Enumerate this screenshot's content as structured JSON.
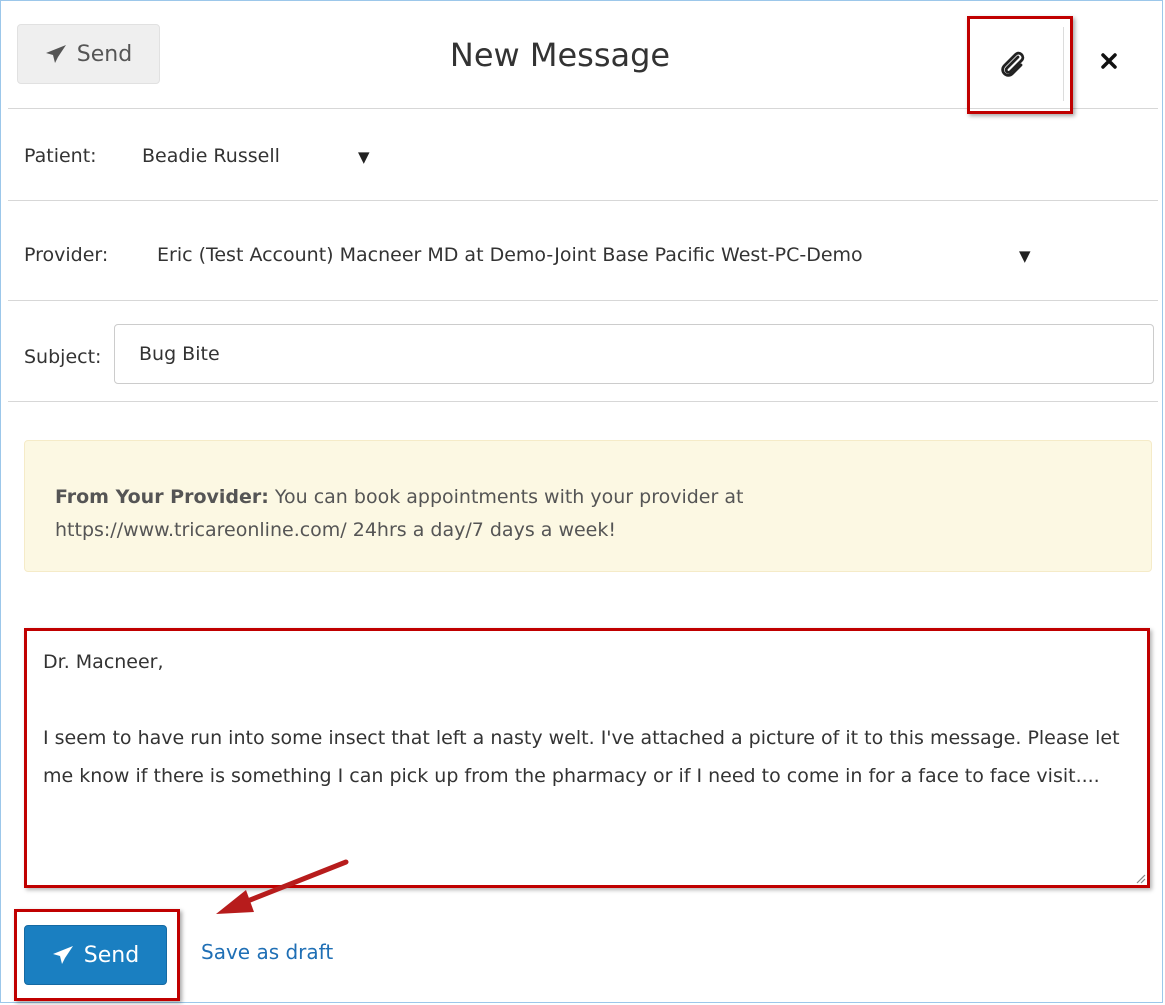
{
  "header": {
    "send_label": "Send",
    "title": "New Message",
    "attach_icon": "paperclip-icon",
    "close_icon": "close-icon"
  },
  "patient": {
    "label": "Patient:",
    "value": "Beadie Russell"
  },
  "provider": {
    "label": "Provider:",
    "value": "Eric (Test Account) Macneer MD at Demo-Joint Base Pacific West-PC-Demo"
  },
  "subject": {
    "label": "Subject:",
    "value": "Bug Bite"
  },
  "notice": {
    "heading": "From Your Provider:",
    "text": " You can book appointments with your provider at",
    "text2": "https://www.tricareonline.com/ 24hrs a day/7 days a week!"
  },
  "message": {
    "body": "Dr. Macneer,\n\nI seem to have run into some insect that left a nasty welt. I've attached a picture of it to this message. Please let me know if there is something I can pick up from the pharmacy or if I need to come in for a face to face visit...."
  },
  "footer": {
    "send_label": "Send",
    "draft_label": "Save as draft"
  },
  "colors": {
    "highlight": "#c00000",
    "primary_button": "#1a7fc1",
    "notice_bg": "#fcf8e3",
    "link": "#1f6fb5"
  }
}
